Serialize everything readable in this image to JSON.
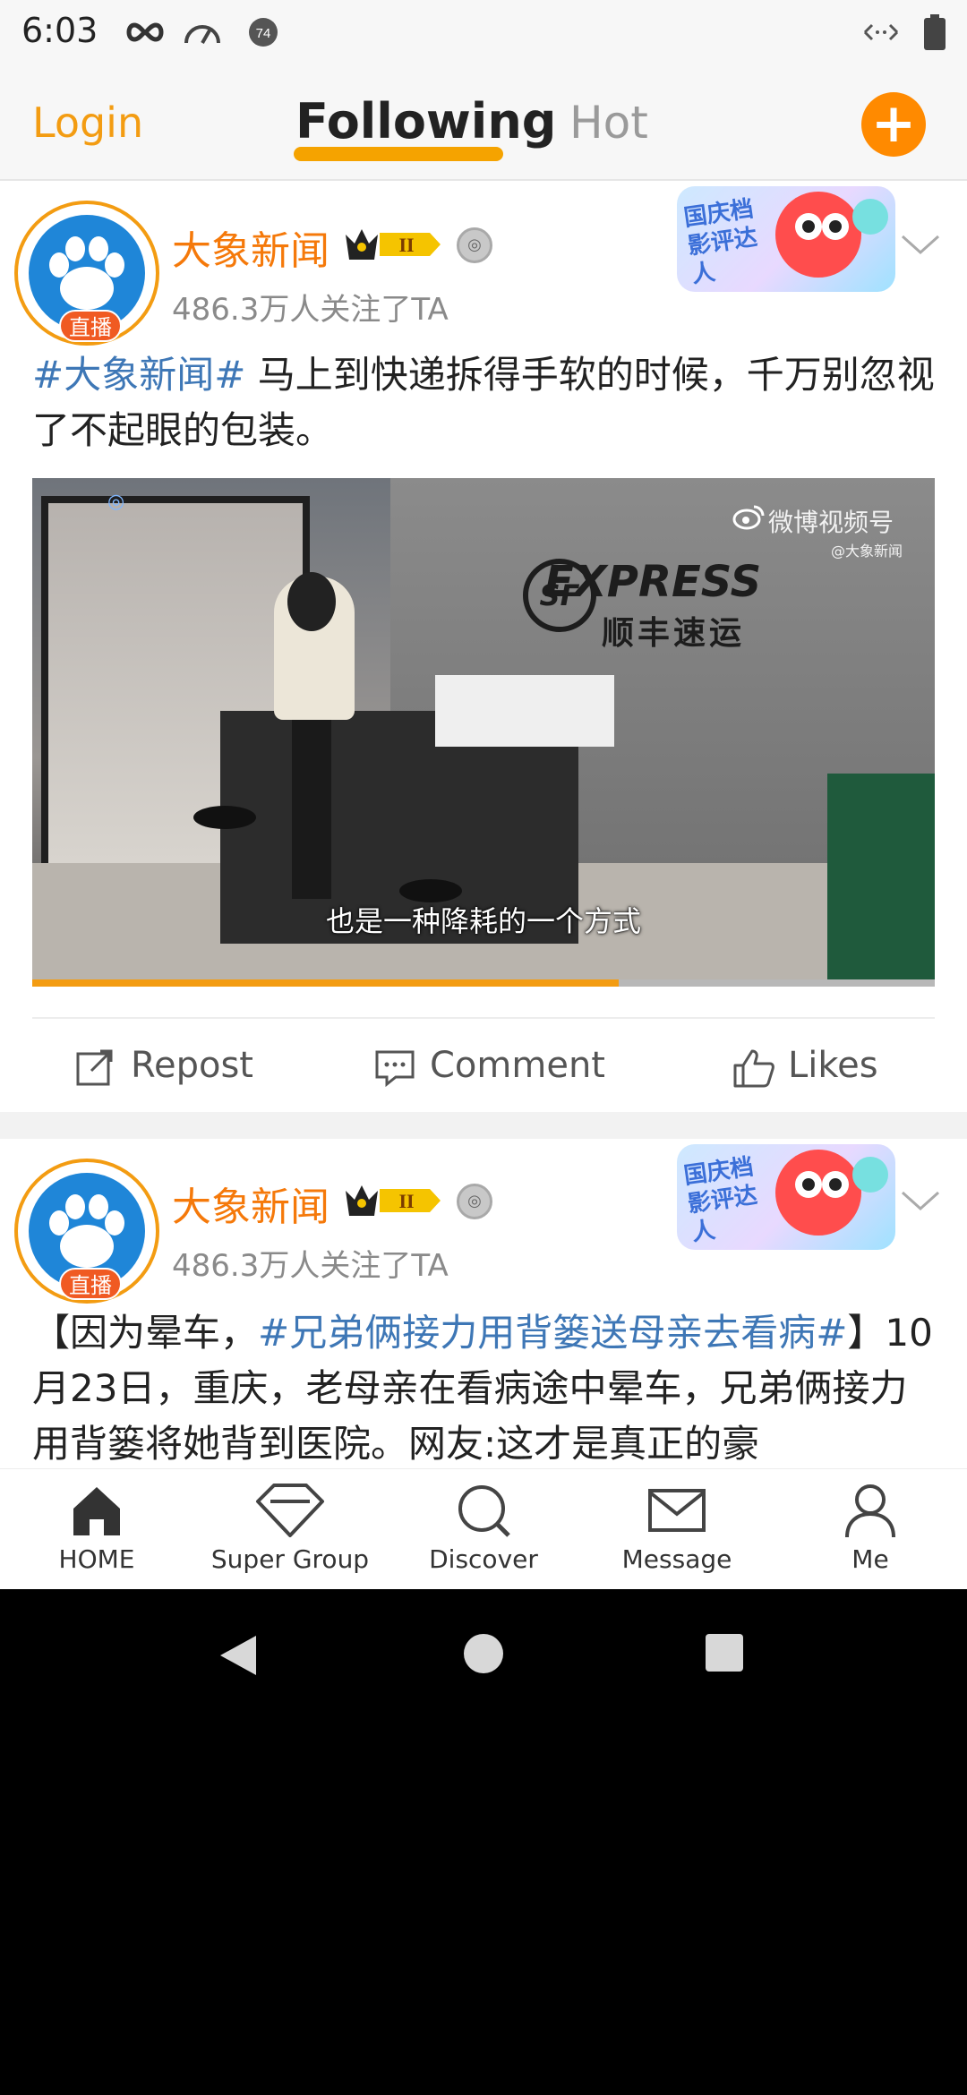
{
  "status_bar": {
    "time": "6:03",
    "badge_number": "74",
    "icons": [
      "infinity-icon",
      "speedometer-icon",
      "notification-badge-icon",
      "data-arrows-icon",
      "battery-icon"
    ]
  },
  "top_nav": {
    "login": "Login",
    "tabs": [
      {
        "label": "Following",
        "active": true
      },
      {
        "label": "Hot",
        "active": false
      }
    ],
    "compose_button": "+"
  },
  "posts": [
    {
      "username": "大象新闻",
      "live_badge": "直播",
      "followers": "486.3万人关注了TA",
      "level_badge": "II",
      "sticker_text": "国庆档影评达人",
      "hashtag": "#大象新闻#",
      "text": " 马上到快递拆得手软的时候，千万别忽视了不起眼的包装。",
      "video": {
        "brand": "EXPRESS",
        "brand_cn": "顺丰速运",
        "logo": "SF",
        "watermark": "微博视频号",
        "watermark_sub": "@大象新闻",
        "caption": "也是一种降耗的一个方式",
        "progress": 0.65
      },
      "actions": {
        "repost": "Repost",
        "comment": "Comment",
        "likes": "Likes"
      }
    },
    {
      "username": "大象新闻",
      "live_badge": "直播",
      "followers": "486.3万人关注了TA",
      "level_badge": "II",
      "sticker_text": "国庆档影评达人",
      "text_before": "【因为晕车，",
      "hashtag": "#兄弟俩接力用背篓送母亲去看病#",
      "text_after": "】10月23日，重庆，老母亲在看病途中晕车，兄弟俩接力用背篓将她背到医院。网友:这才是真正的豪"
    }
  ],
  "tabbar": [
    {
      "label": "HOME",
      "icon": "home-icon"
    },
    {
      "label": "Super Group",
      "icon": "diamond-icon"
    },
    {
      "label": "Discover",
      "icon": "search-icon"
    },
    {
      "label": "Message",
      "icon": "envelope-icon"
    },
    {
      "label": "Me",
      "icon": "person-icon"
    }
  ],
  "colors": {
    "accent": "#f39c12",
    "username": "#f5790a",
    "hashtag": "#3e77b6",
    "plus_button": "#ff8a00"
  }
}
